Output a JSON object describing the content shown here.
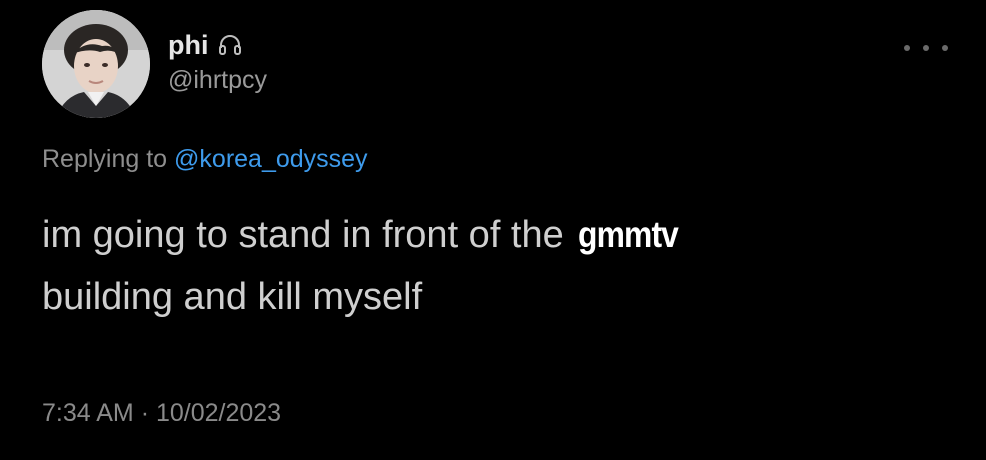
{
  "tweet": {
    "author": {
      "display_name": "phi",
      "handle": "@ihrtpcy",
      "badge_icon": "headphones-icon",
      "avatar_icon": "avatar-photo"
    },
    "more_icon": "more-options-icon",
    "reply": {
      "prefix": "Replying to",
      "mention": "@korea_odyssey"
    },
    "text": {
      "line1": "im going to stand in front of the",
      "overlay_word": "gmmtv",
      "line2": "building and kill myself"
    },
    "timestamp": {
      "time": "7:34 AM",
      "separator": "·",
      "date": "10/02/2023"
    }
  },
  "colors": {
    "background": "#000000",
    "text": "#cfcfcf",
    "muted": "#8e8e8e",
    "link": "#3e9bec"
  }
}
